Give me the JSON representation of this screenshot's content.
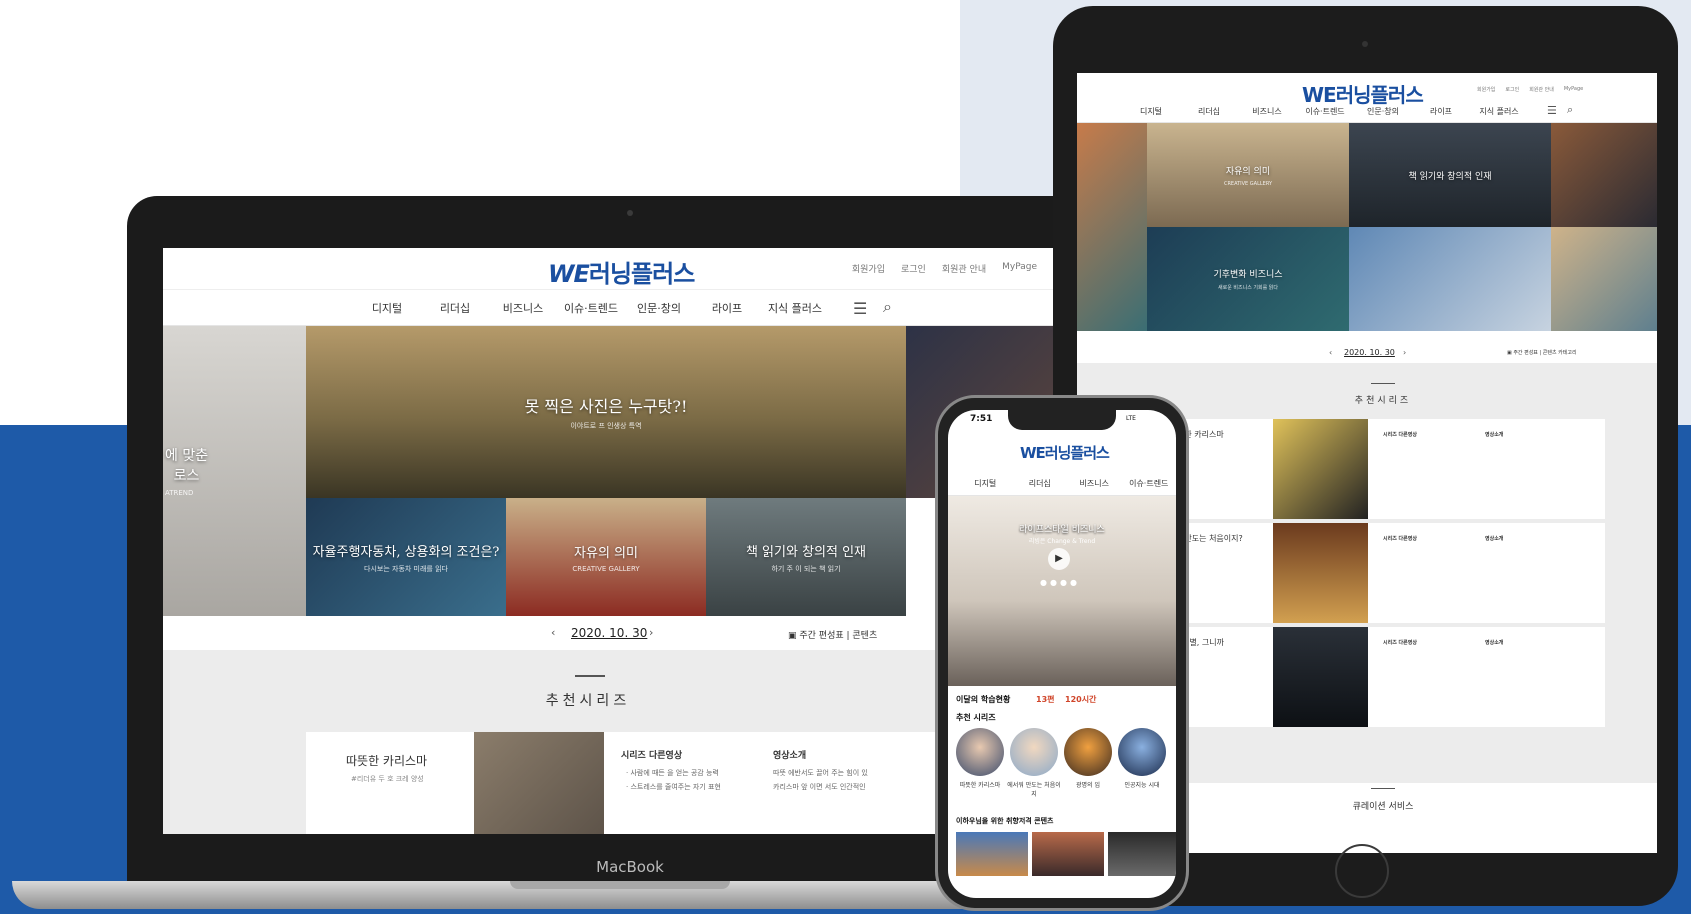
{
  "brand": {
    "logo_we": "WE",
    "logo_text": "러닝플러스",
    "accent": "#1a4fa0"
  },
  "laptop": {
    "util": [
      "회원가입",
      "로그인",
      "회원관 안내",
      "MyPage"
    ],
    "nav": [
      "디지털",
      "리더십",
      "비즈니스",
      "이슈·트렌드",
      "인문·창의",
      "라이프",
      "지식 플러스"
    ],
    "hero": {
      "left_title": "에 맞춘\n로스",
      "left_sub": "ATREND",
      "main_title": "못 찍은 사진은 누구탓?!",
      "main_sub": "이야트로 프 인생상 특역",
      "tile1_title": "자율주행자동차, 상용화의 조건은?",
      "tile1_sub": "다시보는 자동차 미래를 읽다",
      "tile2_title": "자유의 의미",
      "tile2_sub": "CREATIVE GALLERY",
      "tile3_title": "책 읽기와 창의적 인재",
      "tile3_sub": "하기 주 이 되는 책 읽기"
    },
    "date": {
      "prev": "‹",
      "value": "2020. 10. 30",
      "next": "›"
    },
    "weekly": "▣ 주간 편성표  |  콘텐츠",
    "recommend": {
      "title": "추천시리즈",
      "card": {
        "name": "따뜻한 카리스마",
        "tag": "#리더유 두 호 크레 양성",
        "head1": "시리즈 다른영상",
        "line1": "· 사람에 때든 을 얻는 공감 능력",
        "line2": "· 스트레스를 줄여주는 자기 표현",
        "head2": "영상소개",
        "line3": "따뜻 에반서도 끌어 주는 힘이 있",
        "line4": "카리스마 앞 이면 서도 인간적인"
      }
    },
    "model": "MacBook"
  },
  "tablet": {
    "util": [
      "회원가입",
      "로그인",
      "회원관 안내",
      "MyPage"
    ],
    "nav": [
      "디지털",
      "리더십",
      "비즈니스",
      "이슈·트렌드",
      "인문·창의",
      "라이프",
      "지식 플러스"
    ],
    "hero": {
      "t1": "자유의 의미",
      "t1s": "CREATIVE GALLERY",
      "t2": "책 읽기와 창의적 인재",
      "t3": "기후변화 비즈니스",
      "t3s": "새로운 비즈니스 기회를 읽다"
    },
    "date": {
      "prev": "‹",
      "value": "2020. 10. 30",
      "next": "›"
    },
    "weekly": "▣ 주간 편성표  |  콘텐츠 카테고리",
    "recommend_title": "추천시리즈",
    "rows": [
      {
        "name": "뜻한 카리스마",
        "h1": "시리즈 다른영상",
        "h2": "영상소개"
      },
      {
        "name": "I, 만도는 처음이지?",
        "h1": "시리즈 다른영상",
        "h2": "영상소개"
      },
      {
        "name": "주, 별, 그니까",
        "h1": "시리즈 다른영상",
        "h2": "영상소개"
      }
    ],
    "curation": "큐레이션 서비스"
  },
  "phone": {
    "time": "7:51",
    "signal": "LTE",
    "nav": [
      "디지털",
      "리더십",
      "비즈니스",
      "이슈·트렌드"
    ],
    "hero_title": "라이프스타일 비즈니스",
    "hero_sub": "리빙은 Change & Trend",
    "hero_progress": {
      "slide": 1,
      "total": 4
    },
    "stat_label": "이달의 학습현황",
    "stat_a": "13편",
    "stat_b": "120시간",
    "rec_label": "추천 시리즈",
    "avatars": [
      "따뜻한 카리스마",
      "에서워 만도는 처음이지",
      "광명의 임",
      "인공지능 시대"
    ],
    "taste": "이하우님을 위한 취향저격 콘텐츠"
  }
}
